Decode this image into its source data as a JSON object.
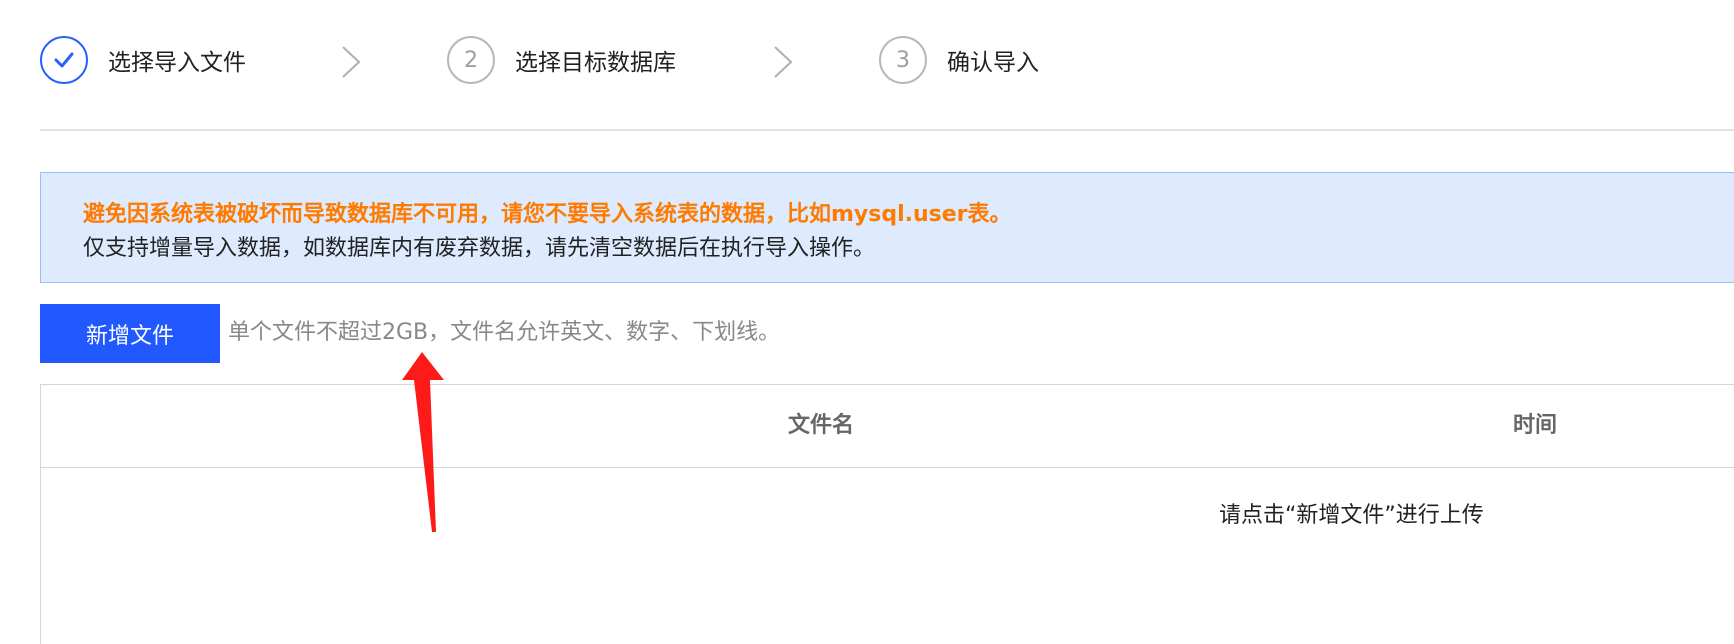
{
  "steps": [
    {
      "label": "选择导入文件",
      "status": "done"
    },
    {
      "label": "选择目标数据库",
      "number": "2",
      "status": "todo"
    },
    {
      "label": "确认导入",
      "number": "3",
      "status": "todo"
    }
  ],
  "notice": {
    "warning": "避免因系统表被破坏而导致数据库不可用，请您不要导入系统表的数据，比如mysql.user表。",
    "info": "仅支持增量导入数据，如数据库内有废弃数据，请先清空数据后在执行导入操作。"
  },
  "toolbar": {
    "add_file_label": "新增文件",
    "hint": "单个文件不超过2GB，文件名允许英文、数字、下划线。"
  },
  "table": {
    "columns": [
      "文件名",
      "时间"
    ],
    "empty_text": "请点击“新增文件”进行上传"
  },
  "colors": {
    "primary": "#2158ff",
    "warning": "#ff7a00",
    "notice_bg": "#deebff",
    "annotation": "#ff1a1a"
  },
  "icons": {
    "step_done": "check-icon",
    "step_separator": "chevron-right-icon",
    "annotation": "red-arrow-icon"
  }
}
